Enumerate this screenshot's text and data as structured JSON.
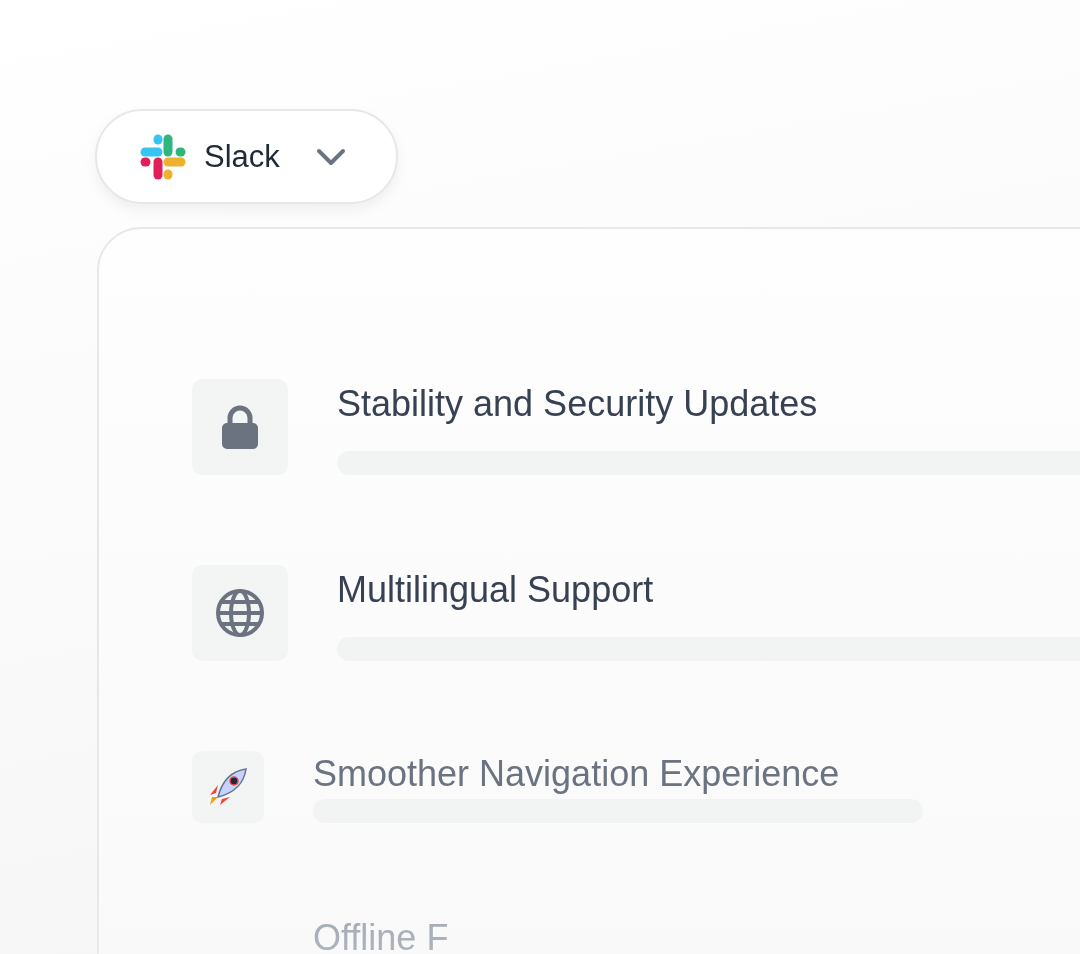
{
  "app_selector": {
    "label": "Slack"
  },
  "updates": [
    {
      "kind": "lock",
      "title": "Stability and Security Updates"
    },
    {
      "kind": "globe",
      "title": "Multilingual Support"
    },
    {
      "kind": "rocket",
      "title": "Smoother Navigation Experience"
    },
    {
      "title": "Offline F"
    }
  ]
}
